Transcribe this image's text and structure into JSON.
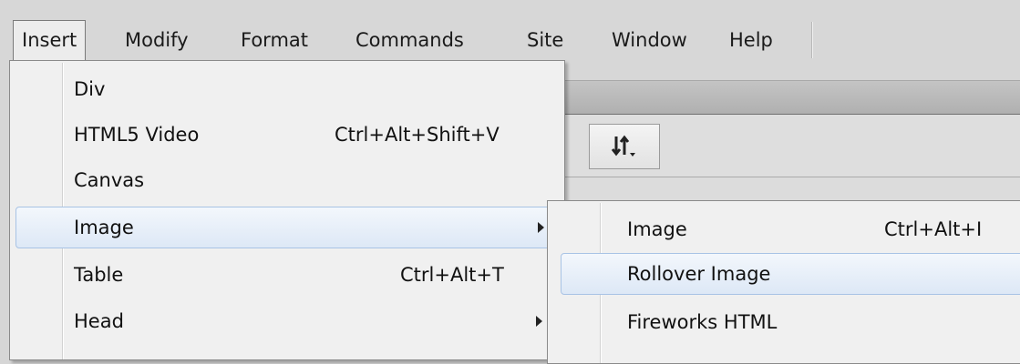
{
  "menubar": {
    "items": [
      {
        "label": "Insert",
        "active": true
      },
      {
        "label": "Modify"
      },
      {
        "label": "Format"
      },
      {
        "label": "Commands"
      },
      {
        "label": "Site"
      },
      {
        "label": "Window"
      },
      {
        "label": "Help"
      }
    ]
  },
  "insert_menu": {
    "items": [
      {
        "label": "Div",
        "shortcut": ""
      },
      {
        "label": "HTML5 Video",
        "shortcut": "Ctrl+Alt+Shift+V"
      },
      {
        "label": "Canvas",
        "shortcut": ""
      },
      {
        "label": "Image",
        "shortcut": "",
        "submenu": true,
        "highlighted": true
      },
      {
        "label": "Table",
        "shortcut": "Ctrl+Alt+T"
      },
      {
        "label": "Head",
        "shortcut": "",
        "submenu": true
      }
    ]
  },
  "image_submenu": {
    "items": [
      {
        "label": "Image",
        "shortcut": "Ctrl+Alt+I"
      },
      {
        "label": "Rollover Image",
        "shortcut": "",
        "highlighted": true
      },
      {
        "label": "Fireworks HTML",
        "shortcut": ""
      }
    ]
  },
  "toolbar": {
    "sort_icon": "sort-icon"
  },
  "colors": {
    "menubar_bg": "#d7d7d7",
    "menu_bg": "#f0f0f0",
    "highlight_border": "#a8c3e5"
  }
}
